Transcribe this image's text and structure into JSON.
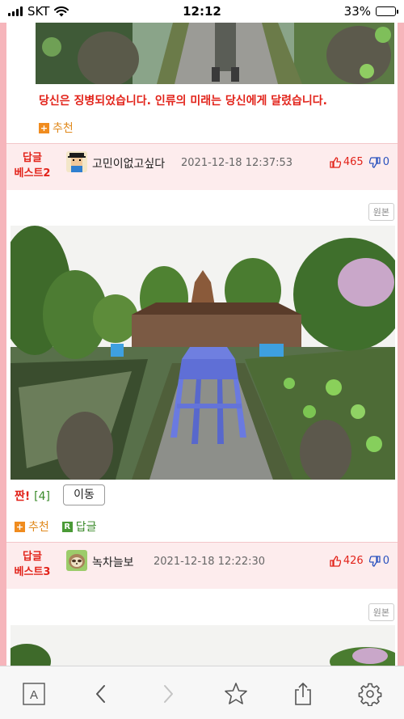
{
  "status_bar": {
    "carrier": "SKT",
    "time": "12:12",
    "battery": "33%",
    "battery_level": 0.33
  },
  "post1": {
    "caption": "당신은 징병되었습니다. 인류의 미래는 당신에게 달렸습니다.",
    "recommend_label": "추천"
  },
  "reply2": {
    "badge_line1": "답글",
    "badge_line2": "베스트2",
    "nickname": "고민이없고싶다",
    "date": "2021-12-18 12:37:53",
    "upvotes": "465",
    "downvotes": "0",
    "original_label": "원본",
    "jjan_label": "짠!",
    "jjan_count": "[4]",
    "move_label": "이동",
    "recommend_label": "추천",
    "reply_label": "답글",
    "avatar_icon": "pixel-person-icon"
  },
  "reply3": {
    "badge_line1": "답글",
    "badge_line2": "베스트3",
    "nickname": "녹차늘보",
    "date": "2021-12-18 12:22:30",
    "upvotes": "426",
    "downvotes": "0",
    "original_label": "원본",
    "avatar_icon": "sloth-icon"
  },
  "toolbar": {
    "reader_label": "A",
    "icons": [
      "reader-icon",
      "back-icon",
      "forward-icon",
      "bookmark-star-icon",
      "share-icon",
      "settings-gear-icon"
    ]
  },
  "colors": {
    "accent_red": "#e2231a",
    "rail_pink": "#f6b5bb",
    "band_pink": "#fdeced",
    "vote_blue": "#2a52be",
    "recommend_orange": "#f08c1f",
    "reply_green": "#4a9a36"
  }
}
